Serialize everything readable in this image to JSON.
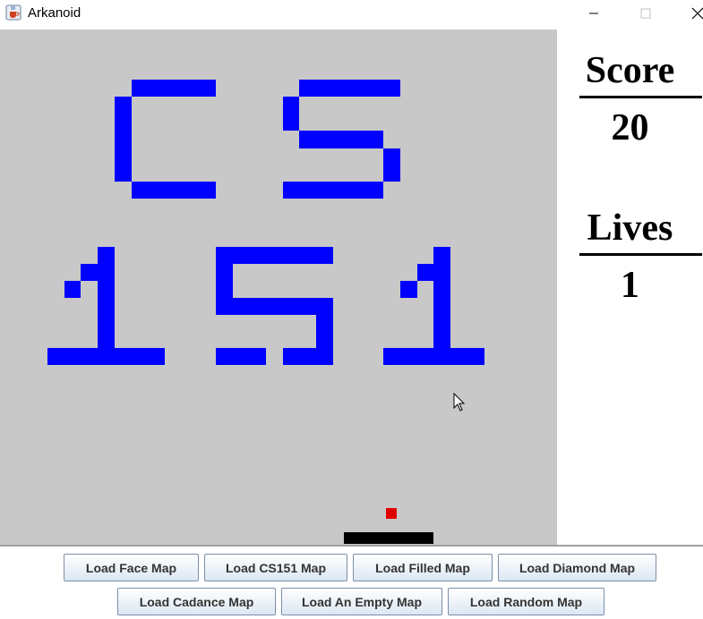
{
  "window": {
    "title": "Arkanoid",
    "icon": "java-cup-icon",
    "controls": [
      "minimize-icon",
      "maximize-icon",
      "close-icon"
    ]
  },
  "game": {
    "background_color": "#c8c8c8",
    "brick_color": "#0000ff",
    "paddle_color": "#000000",
    "ball_color": "#e00000",
    "brick_pattern": "CS 151"
  },
  "stats": {
    "score_label": "Score",
    "score_value": "20",
    "lives_label": "Lives",
    "lives_value": "1"
  },
  "buttons": {
    "face": "Load Face Map",
    "cs151": "Load CS151 Map",
    "filled": "Load Filled Map",
    "diamond": "Load Diamond Map",
    "cadance": "Load Cadance Map",
    "empty": "Load An Empty Map",
    "random": "Load Random Map"
  }
}
